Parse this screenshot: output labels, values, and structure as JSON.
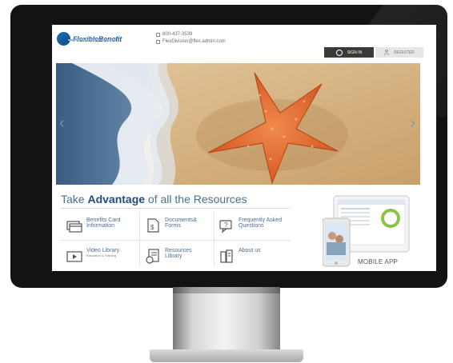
{
  "brand": {
    "name": "FlexibleBenefit",
    "tagline_graphic": true
  },
  "header": {
    "phone": "800-437-3539",
    "email": "FlexDivision@flex.admin.com",
    "signin_label": "SIGN IN",
    "register_label": "REGISTER"
  },
  "hero": {
    "prev_glyph": "‹",
    "next_glyph": "›",
    "image_subject": "starfish-on-beach"
  },
  "resources": {
    "title_prefix": "Take ",
    "title_emphasis": "Advantage",
    "title_suffix": " of all the Resources",
    "items": [
      {
        "label": "Benefits Card\nInformation",
        "sub": "",
        "icon": "card-icon"
      },
      {
        "label": "Documents&\nForms",
        "sub": "",
        "icon": "document-icon"
      },
      {
        "label": "Frequently Asked\nQuestions",
        "sub": "",
        "icon": "faq-icon"
      },
      {
        "label": "Video Library",
        "sub": "Education & Training",
        "icon": "video-icon"
      },
      {
        "label": "Resources\nLibrary",
        "sub": "",
        "icon": "library-icon"
      },
      {
        "label": "About us",
        "sub": "",
        "icon": "about-icon"
      }
    ]
  },
  "mobile": {
    "label": "MOBILE APP"
  },
  "colors": {
    "accent": "#1d4d7c",
    "link": "#4b6d92",
    "sign_in_bg": "#3a3a3a",
    "monitor_frame": "#131313"
  }
}
